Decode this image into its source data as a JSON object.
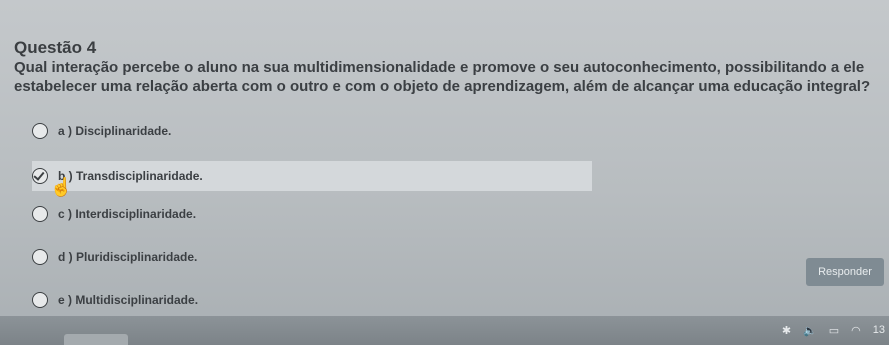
{
  "question": {
    "title": "Questão 4",
    "text": "Qual interação percebe o aluno na sua multidimensionalidade e promove o seu autoconhecimento, possibilitando a ele estabelecer uma relação aberta com o outro e com o objeto de aprendizagem, além de alcançar uma educação integral?"
  },
  "options": [
    {
      "label": "a ) Disciplinaridade.",
      "selected": false
    },
    {
      "label": "b ) Transdisciplinaridade.",
      "selected": true
    },
    {
      "label": "c ) Interdisciplinaridade.",
      "selected": false
    },
    {
      "label": "d ) Pluridisciplinaridade.",
      "selected": false
    },
    {
      "label": "e ) Multidisciplinaridade.",
      "selected": false
    }
  ],
  "actions": {
    "respond_label": "Responder"
  },
  "taskbar": {
    "icons": [
      "bluetooth-icon",
      "volume-icon",
      "battery-icon",
      "wifi-icon"
    ],
    "clock": "13"
  }
}
